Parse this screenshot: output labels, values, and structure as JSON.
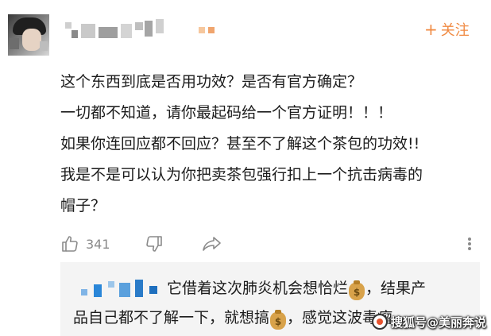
{
  "comment": {
    "follow_label": "关注",
    "follow_plus": "+",
    "lines": [
      "这个东西到底是否用功效？是否有官方确定？",
      "一切都不知道，请你最起码给一个官方证明！！！",
      "如果你连回应都不回应？甚至不了解这个茶包的功效!!",
      "我是不是可以认为你把卖茶包强行扣上一个抗击病毒的",
      "帽子？"
    ],
    "like_count": "341",
    "icons": {
      "like": "thumbs-up-icon",
      "dislike": "thumbs-down-icon",
      "share": "share-arrow-icon",
      "more": "more-vertical-icon",
      "money_bag": "money-bag-emoji"
    }
  },
  "reply": {
    "part1": "它借着这次肺炎机会想恰烂",
    "part2": "，结果产",
    "part3": "品自己都不了解一下，就想搞",
    "part4": "，感觉这波毒瘤",
    "bag_symbol": "$"
  },
  "watermark": {
    "text": "搜狐号@美丽奔说"
  },
  "colors": {
    "accent": "#f08a42",
    "text": "#1b1b1b",
    "muted": "#8a8a8a",
    "reply_bg": "#f4f4f4"
  }
}
